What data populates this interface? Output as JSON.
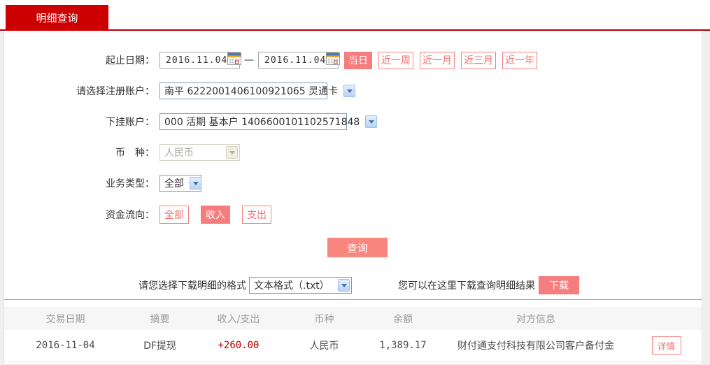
{
  "tab": {
    "label": "明细查询"
  },
  "form": {
    "date_row": {
      "label": "起止日期：",
      "start_date": "2016.11.04",
      "end_date": "2016.11.04",
      "separator": "—",
      "quick_buttons": [
        {
          "label": "当日",
          "active": true
        },
        {
          "label": "近一周",
          "active": false
        },
        {
          "label": "近一月",
          "active": false
        },
        {
          "label": "近三月",
          "active": false
        },
        {
          "label": "近一年",
          "active": false
        }
      ]
    },
    "register_account": {
      "label": "请选择注册账户：",
      "value": "南平 6222001406100921065 灵通卡"
    },
    "sub_account": {
      "label": "下挂账户：",
      "value": "000 活期 基本户 1406600101102571848"
    },
    "currency": {
      "label": "币　种：",
      "value": "人民币",
      "disabled": true
    },
    "business_type": {
      "label": "业务类型：",
      "value": "全部"
    },
    "fund_flow": {
      "label": "资金流向：",
      "options": [
        {
          "label": "全部",
          "active": false
        },
        {
          "label": "收入",
          "active": true
        },
        {
          "label": "支出",
          "active": false
        }
      ]
    },
    "query_button": "查询"
  },
  "download": {
    "format_label": "请您选择下载明细的格式",
    "format_value": "文本格式（.txt）",
    "hint": "您可以在这里下载查询明细结果",
    "button": "下载"
  },
  "table": {
    "headers": [
      "交易日期",
      "摘要",
      "收入/支出",
      "币种",
      "余额",
      "对方信息"
    ],
    "rows": [
      {
        "date": "2016-11-04",
        "summary": "DF提现",
        "amount": "+260.00",
        "currency": "人民币",
        "balance": "1,389.17",
        "counterparty": "财付通支付科技有限公司客户备付金",
        "action": "详情"
      }
    ]
  },
  "colors": {
    "brand_red": "#cc0001",
    "accent_salmon": "#f57d7d",
    "amount_positive_red": "#b60000"
  }
}
